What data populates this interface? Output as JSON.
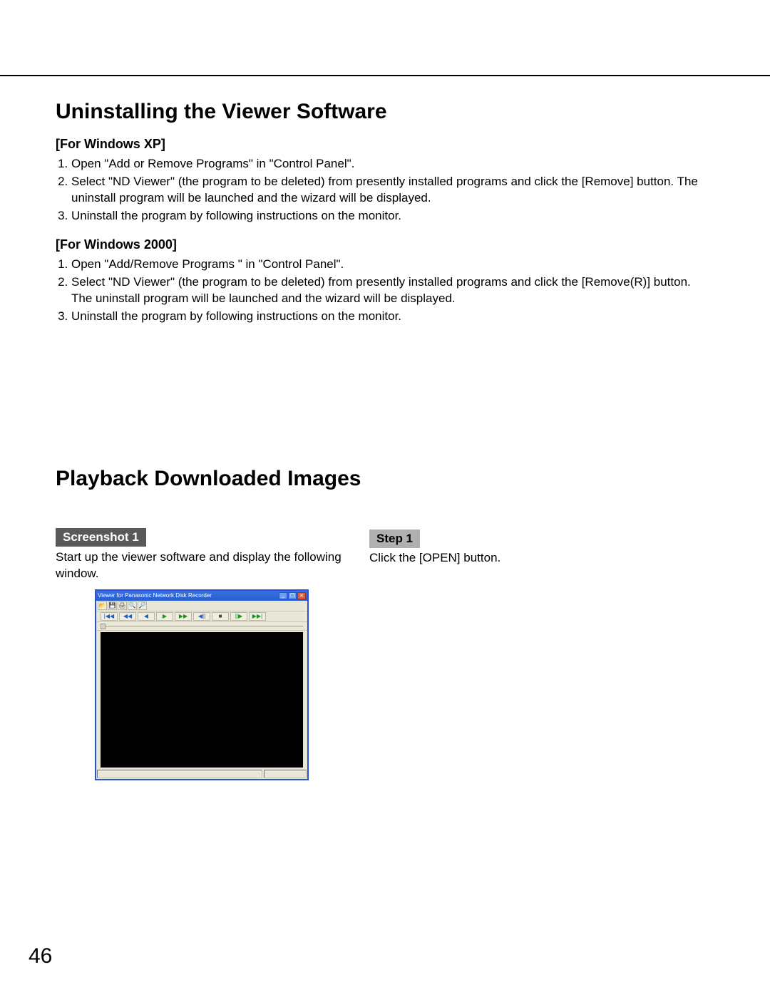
{
  "rule": true,
  "uninstall": {
    "title": "Uninstalling the Viewer Software",
    "xp": {
      "heading": "[For Windows XP]",
      "items": [
        "Open \"Add or Remove Programs\" in \"Control Panel\".",
        "Select \"ND Viewer\" (the program to be deleted) from presently installed programs and click the [Remove] button. The uninstall program will be launched and the wizard will be displayed.",
        "Uninstall the program by following instructions on the monitor."
      ]
    },
    "w2k": {
      "heading": "[For Windows 2000]",
      "items": [
        "Open \"Add/Remove Programs \" in \"Control Panel\".",
        "Select \"ND Viewer\" (the program to be deleted) from presently installed programs and click the [Remove(R)] button.\nThe uninstall program will be launched and the wizard will be displayed.",
        "Uninstall the program by following instructions on the monitor."
      ]
    }
  },
  "playback": {
    "title": "Playback Downloaded Images",
    "screenshot_label": "Screenshot 1",
    "screenshot_desc": "Start up the viewer software and display the following window.",
    "step_label": "Step 1",
    "step_text": "Click the [OPEN] button."
  },
  "viewer": {
    "title": "Viewer for Panasonic Network Disk Recorder",
    "controls": {
      "min": "_",
      "max": "❐",
      "close": "✕"
    },
    "toolbar": {
      "open": "📂",
      "save": "💾",
      "print": "🖨",
      "zoom_in": "🔍",
      "zoom_out": "🔎"
    },
    "transport": {
      "skip_back": "|◀◀",
      "rewind": "◀◀",
      "back": "◀",
      "play": "▶",
      "ff": "▶▶",
      "step_back": "◀||",
      "stop": "■",
      "step_fwd": "||▶",
      "skip_fwd": "▶▶|"
    }
  },
  "page": "46"
}
